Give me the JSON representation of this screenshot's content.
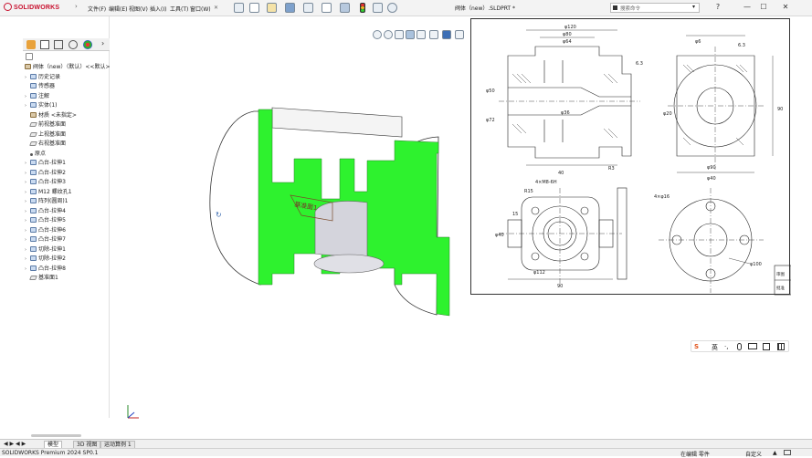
{
  "app": {
    "logo_text": "SOLIDWORKS",
    "menus": [
      "文件(F)",
      "编辑(E)",
      "视图(V)",
      "插入(I)",
      "工具(T)",
      "窗口(W)"
    ],
    "pin_symbol": "✕",
    "document_title": "阀体（new）.SLDPRT *",
    "search_placeholder": "搜索命令",
    "search_dropdown": "▾",
    "help": "?",
    "minimize": "—",
    "maximize": "☐",
    "close": "✕"
  },
  "feature_tree": {
    "root": "阀体（new）（默认）<<默认>",
    "items": [
      {
        "label": "历史记录",
        "icon": "history-icon",
        "expandable": true
      },
      {
        "label": "传感器",
        "icon": "sensor-icon",
        "expandable": false
      },
      {
        "label": "注解",
        "icon": "annotation-icon",
        "expandable": true
      },
      {
        "label": "实体(1)",
        "icon": "solid-body-icon",
        "expandable": true
      },
      {
        "label": "材质 <未指定>",
        "icon": "material-icon",
        "expandable": false
      },
      {
        "label": "前视基准面",
        "icon": "plane-icon",
        "expandable": false
      },
      {
        "label": "上视基准面",
        "icon": "plane-icon",
        "expandable": false
      },
      {
        "label": "右视基准面",
        "icon": "plane-icon",
        "expandable": false
      },
      {
        "label": "原点",
        "icon": "origin-icon",
        "expandable": false
      },
      {
        "label": "凸台-拉伸1",
        "icon": "boss-extrude-icon",
        "expandable": true
      },
      {
        "label": "凸台-拉伸2",
        "icon": "boss-extrude-icon",
        "expandable": true
      },
      {
        "label": "凸台-拉伸3",
        "icon": "boss-extrude-icon",
        "expandable": true
      },
      {
        "label": "M12 螺纹孔1",
        "icon": "hole-icon",
        "expandable": true
      },
      {
        "label": "阵列(圆周)1",
        "icon": "pattern-icon",
        "expandable": true
      },
      {
        "label": "凸台-拉伸4",
        "icon": "boss-extrude-icon",
        "expandable": true
      },
      {
        "label": "凸台-拉伸5",
        "icon": "boss-extrude-icon",
        "expandable": true
      },
      {
        "label": "凸台-拉伸6",
        "icon": "boss-extrude-icon",
        "expandable": true
      },
      {
        "label": "凸台-拉伸7",
        "icon": "boss-extrude-icon",
        "expandable": true
      },
      {
        "label": "切除-拉伸1",
        "icon": "cut-extrude-icon",
        "expandable": true
      },
      {
        "label": "切除-拉伸2",
        "icon": "cut-extrude-icon",
        "expandable": true
      },
      {
        "label": "凸台-拉伸8",
        "icon": "boss-extrude-icon",
        "expandable": true
      },
      {
        "label": "基准面1",
        "icon": "plane-icon",
        "expandable": false
      }
    ]
  },
  "viewport": {
    "section_face_color": "#2ef22e",
    "plane_label": "基准面1"
  },
  "drawing": {
    "dims_front": [
      "φ120",
      "φ80",
      "φ64",
      "6.3",
      "φ50",
      "φ72",
      "40",
      "R3",
      "φ36"
    ],
    "dims_side": [
      "φ6",
      "6.3",
      "φ20",
      "90",
      "φ40",
      "φ90"
    ],
    "dims_plan": [
      "4×M8-6H",
      "R15",
      "15",
      "φ112",
      "φ40",
      "90"
    ],
    "dims_flange": [
      "4×φ16",
      "φ100"
    ],
    "title_block": [
      "审图",
      "批准"
    ]
  },
  "ime": {
    "s_logo": "S",
    "lang": "英",
    "items": [
      "·,",
      "mic",
      "keyboard",
      "shirt",
      "grid"
    ]
  },
  "bottom_tabs": [
    "模型",
    "3D 视图",
    "运动算例 1"
  ],
  "status": {
    "app_version": "SOLIDWORKS Premium 2024 SP0.1",
    "editing": "在编辑 零件",
    "custom": "自定义",
    "arrow": "▲"
  }
}
